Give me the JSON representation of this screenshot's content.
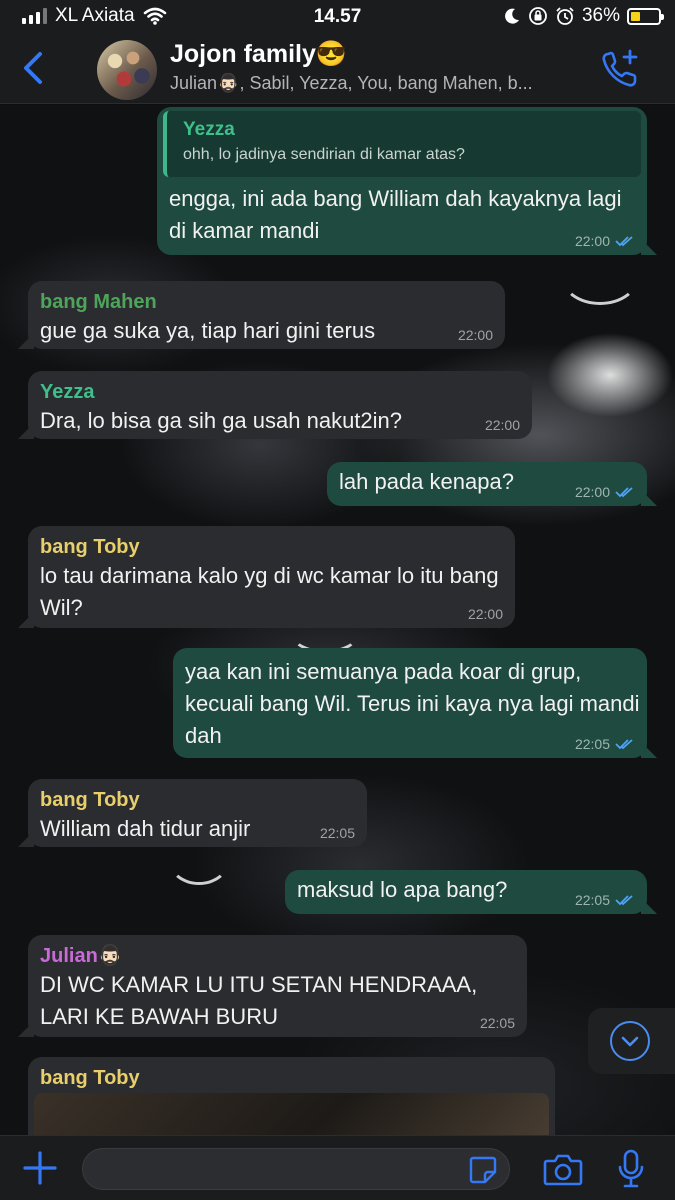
{
  "status_bar": {
    "carrier": "XL Axiata",
    "time": "14.57",
    "battery_percent": "36%",
    "battery_level": 0.36,
    "icons": [
      "signal-icon",
      "wifi-icon",
      "moon-icon",
      "orientation-lock-icon",
      "alarm-icon",
      "battery-icon"
    ]
  },
  "header": {
    "title": "Jojon family😎",
    "subtitle": "Julian🧔🏻‍♂️, Sabil, Yezza, You, bang Mahen, b...",
    "back_icon": "chevron-left-icon",
    "call_icon": "add-call-icon"
  },
  "colors": {
    "accent": "#3478f6",
    "outgoing_bubble": "#1f4a40",
    "incoming_bubble": "#2b2c2f",
    "sender_yezza": "#3fbf8c",
    "sender_mahen": "#4fa45b",
    "sender_toby": "#e8cf6b",
    "sender_julian": "#c86ad8"
  },
  "messages": [
    {
      "direction": "out",
      "quote": {
        "name": "Yezza",
        "text": "ohh, lo jadinya sendirian di kamar atas?"
      },
      "text": "engga, ini ada bang William dah kayaknya lagi di kamar mandi",
      "time": "22:00",
      "read": true
    },
    {
      "direction": "in",
      "sender": "bang Mahen",
      "text": "gue ga suka ya, tiap hari gini terus",
      "time": "22:00"
    },
    {
      "direction": "in",
      "sender": "Yezza",
      "text": "Dra, lo bisa ga sih ga usah nakut2in?",
      "time": "22:00"
    },
    {
      "direction": "out",
      "text": "lah pada kenapa?",
      "time": "22:00",
      "read": true
    },
    {
      "direction": "in",
      "sender": "bang Toby",
      "text": "lo tau darimana kalo yg di wc kamar lo itu bang Wil?",
      "time": "22:00"
    },
    {
      "direction": "out",
      "text": "yaa kan ini semuanya pada koar di grup, kecuali bang Wil. Terus ini kaya nya lagi mandi dah",
      "time": "22:05",
      "read": true
    },
    {
      "direction": "in",
      "sender": "bang Toby",
      "text": "William dah tidur anjir",
      "time": "22:05"
    },
    {
      "direction": "out",
      "text": "maksud lo apa bang?",
      "time": "22:05",
      "read": true
    },
    {
      "direction": "in",
      "sender": "Julian🧔🏻‍♂️",
      "text": "DI WC KAMAR LU ITU SETAN HENDRAAA, LARI KE BAWAH BURU",
      "time": "22:05"
    },
    {
      "direction": "in",
      "sender": "bang Toby",
      "text": "",
      "time": ""
    }
  ],
  "input": {
    "value": "",
    "placeholder": ""
  },
  "input_icons": [
    "plus-icon",
    "sticker-icon",
    "camera-icon",
    "microphone-icon"
  ],
  "scroll_icon": "chevron-down-circle-icon"
}
